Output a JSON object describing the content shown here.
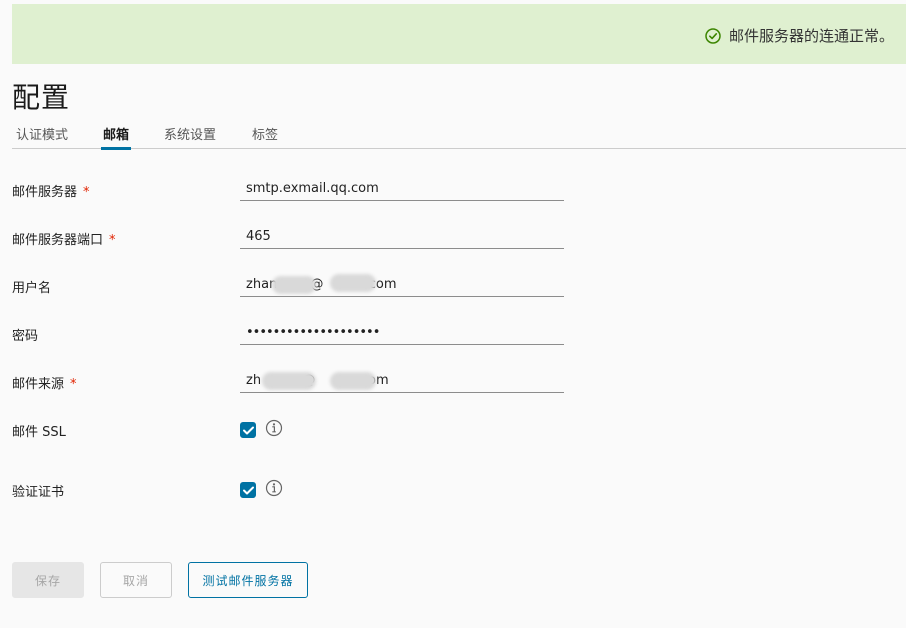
{
  "banner": {
    "message": "邮件服务器的连通正常。",
    "status_color": "#3c8500"
  },
  "page": {
    "title": "配置"
  },
  "tabs": [
    {
      "label": "认证模式",
      "active": false
    },
    {
      "label": "邮箱",
      "active": true
    },
    {
      "label": "系统设置",
      "active": false
    },
    {
      "label": "标签",
      "active": false
    }
  ],
  "form": {
    "mail_server": {
      "label": "邮件服务器",
      "required": "*",
      "value": "smtp.exmail.qq.com"
    },
    "mail_port": {
      "label": "邮件服务器端口",
      "required": "*",
      "value": "465"
    },
    "username": {
      "label": "用户名",
      "value": "zhan        @          .com"
    },
    "password": {
      "label": "密码",
      "value": "••••••••••••••••••••"
    },
    "mail_from": {
      "label": "邮件来源",
      "required": "*",
      "value": "zh          @          .com"
    },
    "mail_ssl": {
      "label": "邮件 SSL",
      "checked": true
    },
    "verify_cert": {
      "label": "验证证书",
      "checked": true
    }
  },
  "buttons": {
    "save": "保存",
    "cancel": "取消",
    "test": "测试邮件服务器"
  },
  "colors": {
    "accent": "#0072a3",
    "banner_bg": "#dff0d0",
    "required": "#e12200"
  }
}
